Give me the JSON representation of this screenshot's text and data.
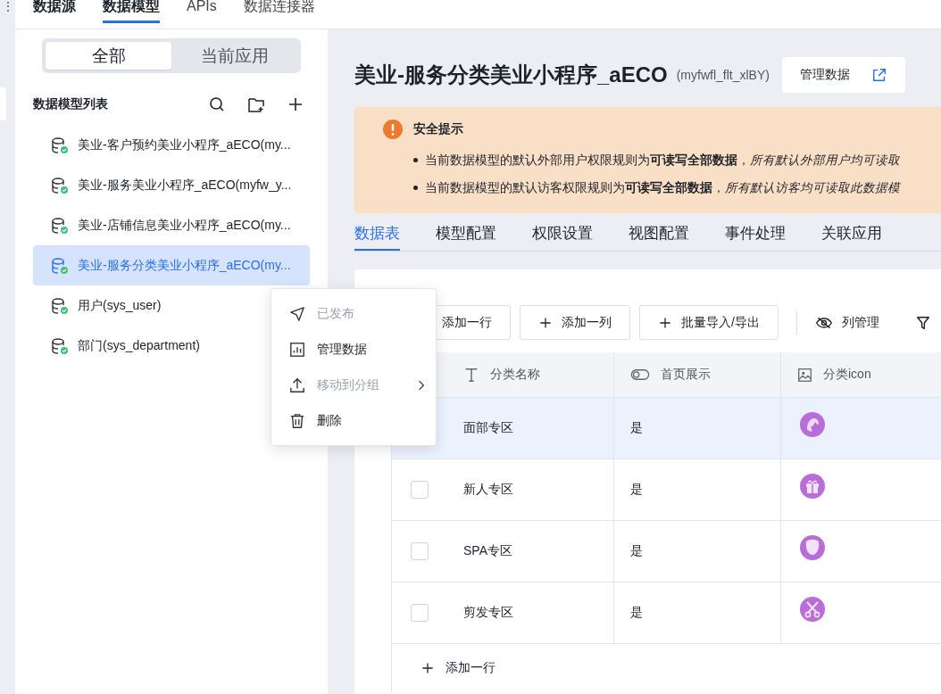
{
  "side_menu": "⋮",
  "top_tabs": [
    {
      "label": "数据源",
      "selected": false,
      "bold": true
    },
    {
      "label": "数据模型",
      "selected": true,
      "bold": true
    },
    {
      "label": "APIs",
      "selected": false,
      "bold": false
    },
    {
      "label": "数据连接器",
      "selected": false,
      "bold": false
    }
  ],
  "scope_switch": [
    {
      "label": "全部",
      "selected": true
    },
    {
      "label": "当前应用",
      "selected": false
    }
  ],
  "model_list": {
    "title": "数据模型列表",
    "items": [
      {
        "label": "美业-客户预约美业小程序_aECO(my...",
        "selected": false
      },
      {
        "label": "美业-服务美业小程序_aECO(myfw_y...",
        "selected": false
      },
      {
        "label": "美业-店铺信息美业小程序_aECO(my...",
        "selected": false
      },
      {
        "label": "美业-服务分类美业小程序_aECO(my...",
        "selected": true
      },
      {
        "label": "用户(sys_user)",
        "selected": false
      },
      {
        "label": "部门(sys_department)",
        "selected": false
      }
    ]
  },
  "context_menu": [
    {
      "label": "已发布",
      "disabled": true,
      "submenu": false
    },
    {
      "label": "管理数据",
      "disabled": false,
      "submenu": false
    },
    {
      "label": "移动到分组",
      "disabled": true,
      "submenu": true
    },
    {
      "label": "删除",
      "disabled": false,
      "submenu": false
    }
  ],
  "model": {
    "title": "美业-服务分类美业小程序_aECO",
    "code": "(myfwfl_flt_xlBY)",
    "manage_button": "管理数据"
  },
  "alert": {
    "title": "安全提示",
    "lines": [
      "当前数据模型的默认外部用户权限规则为**可读写全部数据**，*所有默认外部用户均可读取*",
      "当前数据模型的默认访客权限规则为**可读写全部数据**，*所有默认访客均可读取此数据模*"
    ]
  },
  "tabs": [
    {
      "label": "数据表",
      "selected": true
    },
    {
      "label": "模型配置",
      "selected": false
    },
    {
      "label": "权限设置",
      "selected": false
    },
    {
      "label": "视图配置",
      "selected": false
    },
    {
      "label": "事件处理",
      "selected": false
    },
    {
      "label": "关联应用",
      "selected": false
    }
  ],
  "toolbar": {
    "buttons": [
      "添加一行",
      "添加一列",
      "批量导入/导出"
    ],
    "column_manage": "列管理"
  },
  "table": {
    "columns": [
      {
        "label": "分类名称",
        "kind": "text"
      },
      {
        "label": "首页展示",
        "kind": "switch"
      },
      {
        "label": "分类icon",
        "kind": "image"
      }
    ],
    "rows": [
      {
        "name": "面部专区",
        "show": "是",
        "highlighted": true
      },
      {
        "name": "新人专区",
        "show": "是",
        "highlighted": false
      },
      {
        "name": "SPA专区",
        "show": "是",
        "highlighted": false
      },
      {
        "name": "剪发专区",
        "show": "是",
        "highlighted": false
      }
    ],
    "add_row": "添加一行"
  }
}
